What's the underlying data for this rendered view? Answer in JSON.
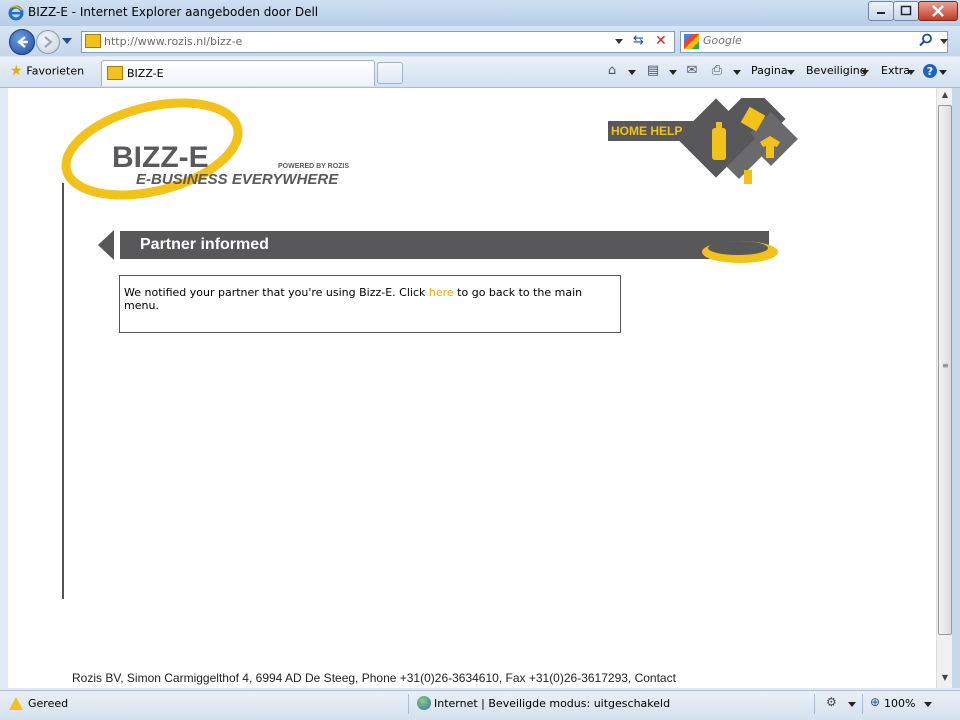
{
  "window": {
    "title": "BIZZ-E - Internet Explorer aangeboden door Dell"
  },
  "address_bar": {
    "url": "http://www.rozis.nl/bizz-e"
  },
  "search": {
    "placeholder": "Google"
  },
  "tabs": {
    "favorites_label": "Favorieten",
    "active_tab_label": "BIZZ-E"
  },
  "command_bar": {
    "page_label": "Pagina",
    "security_label": "Beveiliging",
    "extra_label": "Extra",
    "help_icon": "help-icon"
  },
  "page": {
    "logo": {
      "brand": "BIZZ-E",
      "tagline": "E-BUSINESS EVERYWHERE",
      "powered_by": "POWERED BY ROZIS"
    },
    "home_help_label": "HOME HELP",
    "banner_title": "Partner informed",
    "message": {
      "before": "We notified your partner that you're using Bizz-E. Click ",
      "link": "here",
      "after": " to go back to the main menu."
    },
    "footer": "Rozis BV, Simon Carmiggelthof 4, 6994 AD De Steeg, Phone +31(0)26-3634610, Fax +31(0)26-3617293, Contact"
  },
  "status_bar": {
    "status": "Gereed",
    "zone": "Internet | Beveiligde modus: uitgeschakeld",
    "zoom": "100%"
  },
  "colors": {
    "accent_yellow": "#f3c21a",
    "banner_gray": "#58585a",
    "link": "#e6a817"
  }
}
